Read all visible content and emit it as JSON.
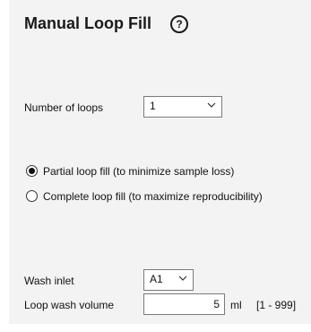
{
  "header": {
    "title": "Manual Loop Fill",
    "help_icon": "question-circle-icon"
  },
  "loops": {
    "label": "Number of loops",
    "value": "1"
  },
  "fill_mode": {
    "options": [
      {
        "label": "Partial loop fill (to minimize sample loss)",
        "selected": true
      },
      {
        "label": "Complete loop fill (to maximize reproducibility)",
        "selected": false
      }
    ]
  },
  "wash_inlet": {
    "label": "Wash inlet",
    "value": "A1"
  },
  "loop_wash_volume": {
    "label": "Loop wash volume",
    "value": "5",
    "unit": "ml",
    "range": "[1 - 999]"
  },
  "colors": {
    "panel_background": "#f3f3f3",
    "control_border": "#7a7a7a",
    "text": "#111111"
  }
}
